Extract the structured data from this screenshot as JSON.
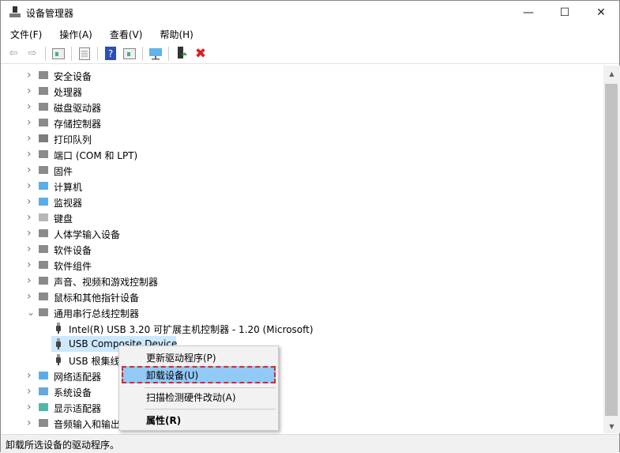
{
  "window": {
    "title": "设备管理器",
    "minimize": "—",
    "maximize": "☐",
    "close": "✕"
  },
  "menubar": [
    "文件(F)",
    "操作(A)",
    "查看(V)",
    "帮助(H)"
  ],
  "toolbar": [
    "back-icon",
    "forward-icon",
    "show-hide-tree-icon",
    "properties-icon",
    "help-icon",
    "action-pane-icon",
    "monitor-icon",
    "update-driver-icon",
    "uninstall-icon"
  ],
  "tree": [
    {
      "label": "安全设备",
      "level": 0,
      "expanded": false,
      "icon": "security-device-icon"
    },
    {
      "label": "处理器",
      "level": 0,
      "expanded": false,
      "icon": "processor-icon"
    },
    {
      "label": "磁盘驱动器",
      "level": 0,
      "expanded": false,
      "icon": "disk-icon"
    },
    {
      "label": "存储控制器",
      "level": 0,
      "expanded": false,
      "icon": "storage-icon"
    },
    {
      "label": "打印队列",
      "level": 0,
      "expanded": false,
      "icon": "printer-icon"
    },
    {
      "label": "端口 (COM 和 LPT)",
      "level": 0,
      "expanded": false,
      "icon": "port-icon"
    },
    {
      "label": "固件",
      "level": 0,
      "expanded": false,
      "icon": "firmware-icon"
    },
    {
      "label": "计算机",
      "level": 0,
      "expanded": false,
      "icon": "computer-icon"
    },
    {
      "label": "监视器",
      "level": 0,
      "expanded": false,
      "icon": "monitor-icon"
    },
    {
      "label": "键盘",
      "level": 0,
      "expanded": false,
      "icon": "keyboard-icon"
    },
    {
      "label": "人体学输入设备",
      "level": 0,
      "expanded": false,
      "icon": "hid-icon"
    },
    {
      "label": "软件设备",
      "level": 0,
      "expanded": false,
      "icon": "software-device-icon"
    },
    {
      "label": "软件组件",
      "level": 0,
      "expanded": false,
      "icon": "software-component-icon"
    },
    {
      "label": "声音、视频和游戏控制器",
      "level": 0,
      "expanded": false,
      "icon": "sound-icon"
    },
    {
      "label": "鼠标和其他指针设备",
      "level": 0,
      "expanded": false,
      "icon": "mouse-icon"
    },
    {
      "label": "通用串行总线控制器",
      "level": 0,
      "expanded": true,
      "icon": "usb-icon"
    },
    {
      "label": "Intel(R) USB 3.20 可扩展主机控制器 - 1.20 (Microsoft)",
      "level": 1,
      "icon": "usb-plug-icon"
    },
    {
      "label": "USB Composite Device",
      "level": 1,
      "selected": true,
      "icon": "usb-plug-icon"
    },
    {
      "label": "USB 根集线器",
      "level": 1,
      "icon": "usb-plug-icon"
    },
    {
      "label": "网络适配器",
      "level": 0,
      "expanded": false,
      "icon": "network-icon"
    },
    {
      "label": "系统设备",
      "level": 0,
      "expanded": false,
      "icon": "system-icon"
    },
    {
      "label": "显示适配器",
      "level": 0,
      "expanded": false,
      "icon": "display-adapter-icon"
    },
    {
      "label": "音频输入和输出",
      "level": 0,
      "expanded": false,
      "icon": "audio-icon"
    }
  ],
  "context_menu": {
    "update": "更新驱动程序(P)",
    "uninstall": "卸载设备(U)",
    "scan": "扫描检测硬件改动(A)",
    "properties": "属性(R)"
  },
  "status": "卸载所选设备的驱动程序。",
  "colors": {
    "selection": "#cce8ff",
    "highlight": "#91c9f7",
    "dash": "#d9262c"
  }
}
